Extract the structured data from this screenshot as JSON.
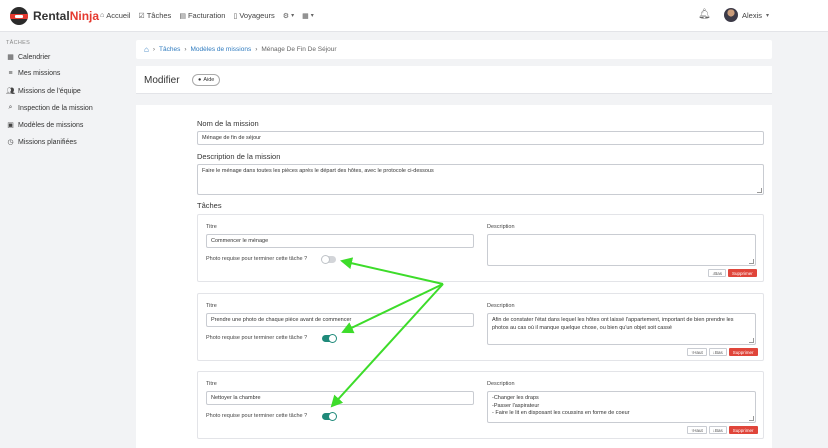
{
  "topbar": {
    "logo_text_a": "Rental",
    "logo_text_b": "Ninja",
    "nav": [
      {
        "icon": "home-icon",
        "label": "Accueil"
      },
      {
        "icon": "tasks-icon",
        "label": "Tâches"
      },
      {
        "icon": "invoice-icon",
        "label": "Facturation"
      },
      {
        "icon": "guests-icon",
        "label": "Voyageurs"
      }
    ],
    "user_name": "Alexis"
  },
  "sidebar": {
    "section": "TÂCHES",
    "items": [
      {
        "icon": "calendar-icon",
        "label": "Calendrier"
      },
      {
        "icon": "list-icon",
        "label": "Mes missions"
      },
      {
        "icon": "team-icon",
        "label": "Missions de l'équipe"
      },
      {
        "icon": "search-icon",
        "label": "Inspection de la mission"
      },
      {
        "icon": "template-icon",
        "label": "Modèles de missions"
      },
      {
        "icon": "clock-icon",
        "label": "Missions planifiées"
      }
    ]
  },
  "breadcrumb": {
    "items": [
      "Tâches",
      "Modèles de missions",
      "Ménage De Fin De Séjour"
    ]
  },
  "header": {
    "title": "Modifier",
    "help_label": "Aide"
  },
  "form": {
    "name_label": "Nom de la mission",
    "name_value": "Ménage de fin de séjour",
    "desc_label": "Description de la mission",
    "desc_value": "Faire le ménage dans toutes les pièces après le départ des hôtes, avec le protocole ci-dessous",
    "tasks_label": "Tâches",
    "title_label": "Titre",
    "description_label": "Description",
    "photo_label": "Photo requise pour terminer cette tâche ?",
    "btn_up": "Haut",
    "btn_down": "Bas",
    "btn_delete": "Supprimer",
    "tasks": [
      {
        "title": "Commencer le ménage",
        "description": "",
        "photo_required": false
      },
      {
        "title": "Prendre une photo de chaque pièce avant  de commencer",
        "description": "Afin de constater l'état dans lequel les hôtes ont laissé l'appartement, important de bien prendre les photos au cas où il manque quelque chose, ou bien qu'un objet soit cassé",
        "photo_required": true
      },
      {
        "title": "Nettoyer la chambre",
        "description_lines": [
          "-Changer les draps",
          "-Passer l'aspirateur",
          "- Faire le lit en disposant les coussins en forme de coeur"
        ],
        "photo_required": true
      }
    ]
  },
  "colors": {
    "accent": "#e5392f",
    "toggle_on": "#1f8a7a",
    "annotation_arrow": "#3ddc2a",
    "link": "#2f7bbf"
  }
}
